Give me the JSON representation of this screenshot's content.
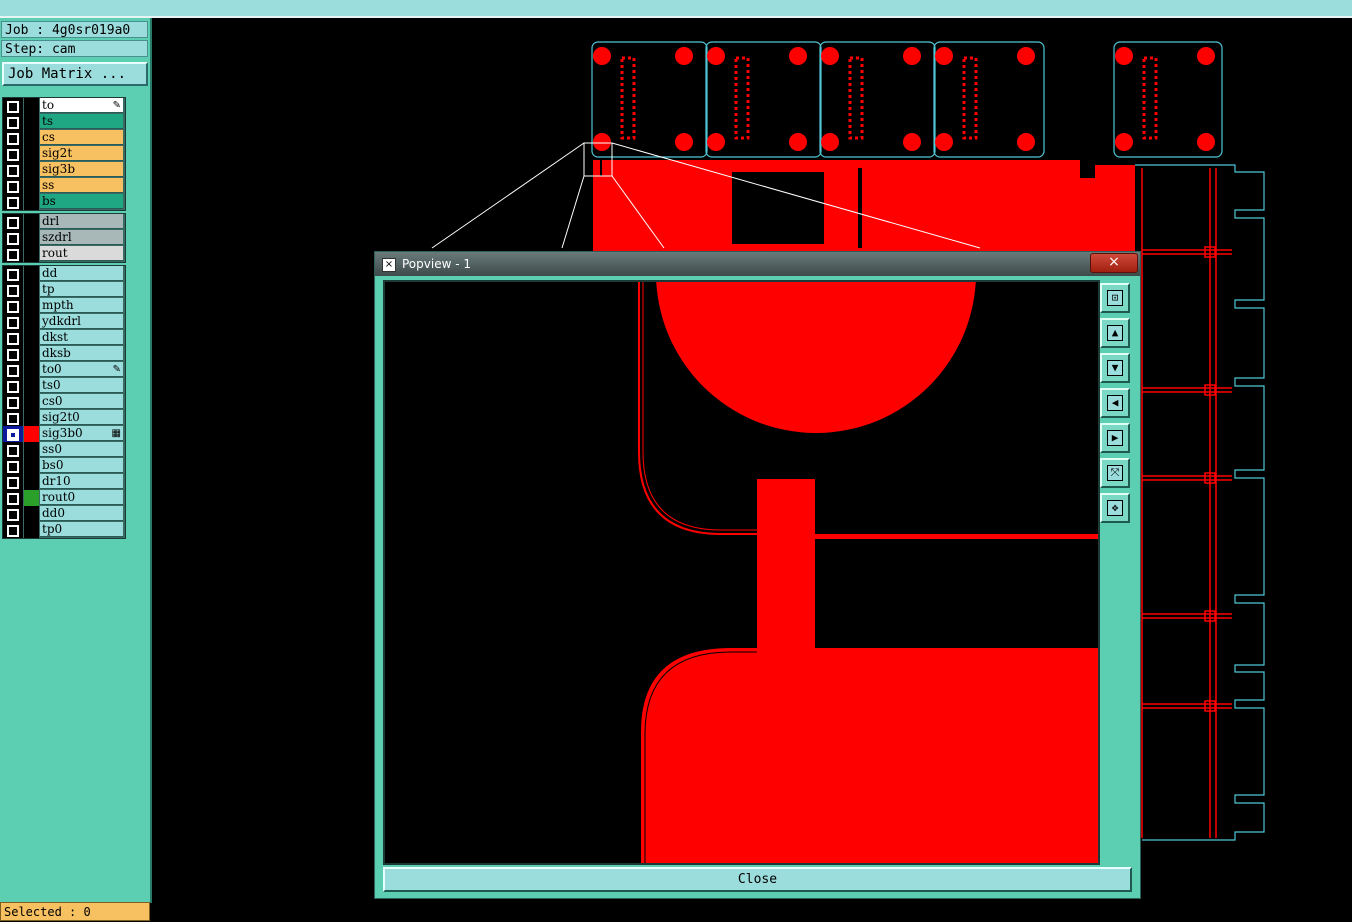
{
  "header": {
    "job": "Job : 4g0sr019a0",
    "step": "Step: cam",
    "job_matrix": "Job Matrix ..."
  },
  "groups": [
    {
      "layers": [
        {
          "name": "to",
          "color": "#ffffff",
          "mark": "edit"
        },
        {
          "name": "ts",
          "color": "#1fa783"
        },
        {
          "name": "cs",
          "color": "#f7c060"
        },
        {
          "name": "sig2t",
          "color": "#f7c060"
        },
        {
          "name": "sig3b",
          "color": "#f7c060"
        },
        {
          "name": "ss",
          "color": "#f7c060"
        },
        {
          "name": "bs",
          "color": "#1fa783"
        }
      ]
    },
    {
      "layers": [
        {
          "name": "drl",
          "color": "#a8b8b8"
        },
        {
          "name": "szdrl",
          "color": "#a8b8b8"
        },
        {
          "name": "rout",
          "color": "#dadada"
        }
      ]
    },
    {
      "layers": [
        {
          "name": "dd",
          "color": "#9bdcdc"
        },
        {
          "name": "tp",
          "color": "#9bdcdc"
        },
        {
          "name": "mpth",
          "color": "#9bdcdc"
        },
        {
          "name": "ydkdrl",
          "color": "#9bdcdc"
        },
        {
          "name": "dkst",
          "color": "#9bdcdc"
        },
        {
          "name": "dksb",
          "color": "#9bdcdc"
        },
        {
          "name": "to0",
          "color": "#9bdcdc",
          "mark": "edit"
        },
        {
          "name": "ts0",
          "color": "#9bdcdc"
        },
        {
          "name": "cs0",
          "color": "#9bdcdc"
        },
        {
          "name": "sig2t0",
          "color": "#9bdcdc"
        },
        {
          "name": "sig3b0",
          "color": "#9bdcdc",
          "selected": true,
          "swatch": "#ff0000",
          "mark": "grid"
        },
        {
          "name": "ss0",
          "color": "#9bdcdc"
        },
        {
          "name": "bs0",
          "color": "#9bdcdc"
        },
        {
          "name": "dr10",
          "color": "#9bdcdc"
        },
        {
          "name": "rout0",
          "color": "#9bdcdc",
          "swatch": "#2aa02a"
        },
        {
          "name": "dd0",
          "color": "#9bdcdc"
        },
        {
          "name": "tp0",
          "color": "#9bdcdc"
        }
      ]
    }
  ],
  "status": {
    "selected": "Selected : 0"
  },
  "popup": {
    "title": "Popview - 1",
    "close_x": "×",
    "close_label": "Close",
    "tools": [
      "zoom-window-icon",
      "pan-up-icon",
      "pan-down-icon",
      "pan-left-icon",
      "pan-right-icon",
      "zoom-fit-icon",
      "zoom-home-icon"
    ]
  },
  "colors": {
    "copper": "#ff0000",
    "outline": "#4fc7d6",
    "panel": "#5ccfb3"
  }
}
